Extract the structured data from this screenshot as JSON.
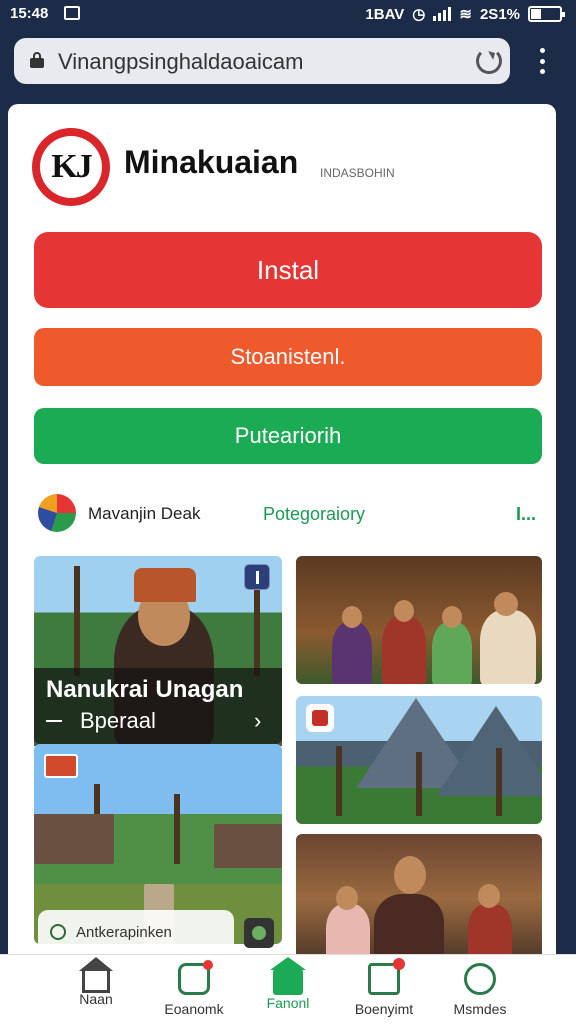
{
  "status_bar": {
    "time": "15:48",
    "carrier": "1BAV",
    "battery": "2S1%"
  },
  "browser": {
    "url": "Vinangpsinghaldaoaicam"
  },
  "app": {
    "name": "Minakuaian",
    "subtitle": "INDASBOHIN",
    "logo_text": "KJ"
  },
  "buttons": {
    "install": "Instal",
    "second": "Stoanistenl.",
    "third": "Puteariorih"
  },
  "developer": {
    "name": "Mavanjin Deak",
    "category": "Potegoraiory",
    "more": "I..."
  },
  "gallery": {
    "caption_title": "Nanukrai Unagan",
    "caption_sub": "Bperaal",
    "pill_text": "Antkerapinken"
  },
  "bottom_nav": [
    {
      "label": "Naan"
    },
    {
      "label": "Eoanomk"
    },
    {
      "label": "Fanonl"
    },
    {
      "label": "Boenyimt"
    },
    {
      "label": "Msmdes"
    }
  ],
  "colors": {
    "primary_red": "#e53535",
    "orange": "#ef5a2d",
    "green": "#1bab55"
  }
}
